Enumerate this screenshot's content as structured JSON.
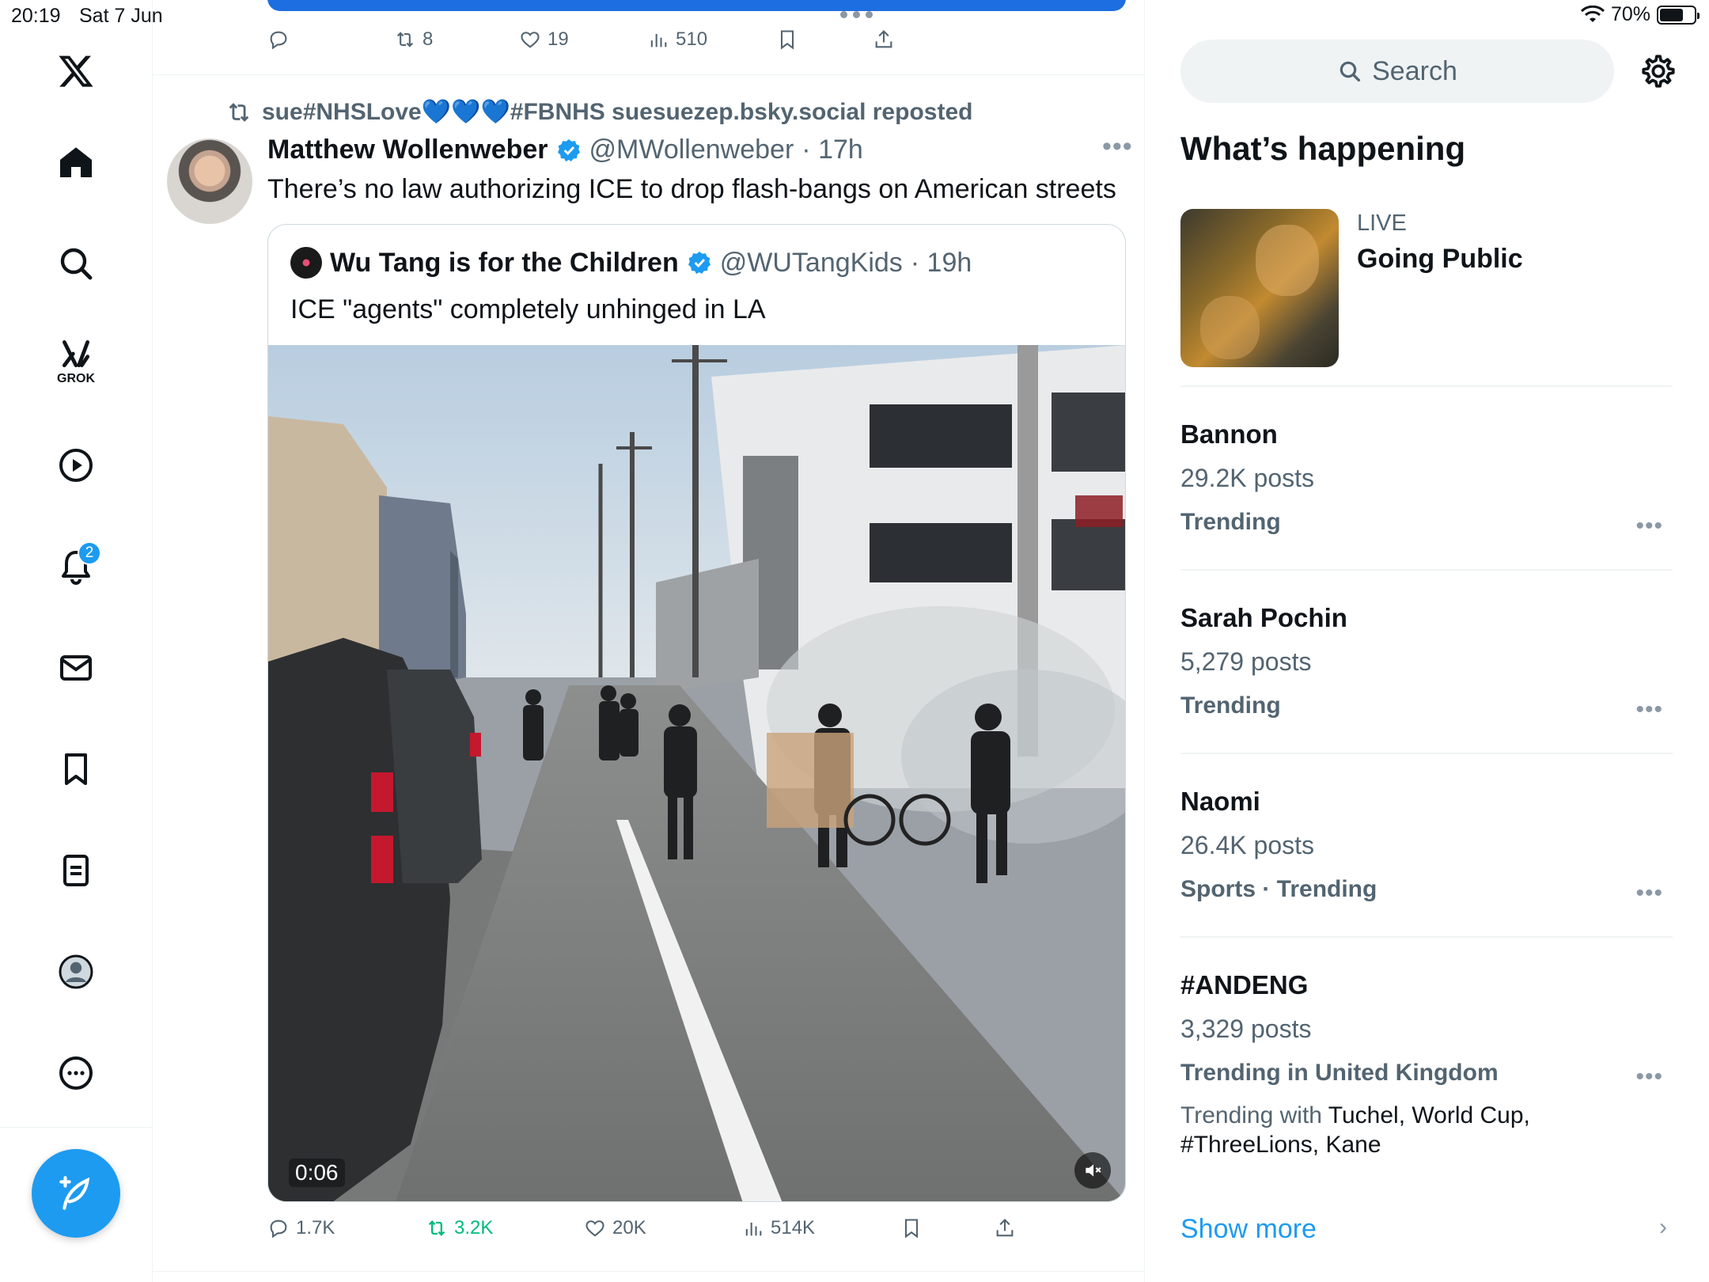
{
  "status_bar": {
    "time": "20:19",
    "date": "Sat 7 Jun",
    "battery": "70%"
  },
  "nav": {
    "grok_label": "GROK",
    "notifications_badge": "2"
  },
  "previous_post": {
    "actions": {
      "reply": "",
      "repost": "8",
      "like": "19",
      "views": "510"
    }
  },
  "post": {
    "reposted_by": "sue#NHSLove💙💙💙#FBNHS suesuezep.bsky.social reposted",
    "author_name": "Matthew Wollenweber",
    "author_handle": "@MWollenweber",
    "time": "· 17h",
    "text": "There’s no law authorizing ICE to drop flash-bangs on American streets",
    "quote": {
      "author_name": "Wu Tang is for the Children",
      "author_handle": "@WUTangKids",
      "time": "· 19h",
      "text": "ICE \"agents\" completely unhinged in LA",
      "video_time": "0:06"
    },
    "actions": {
      "reply": "1.7K",
      "repost": "3.2K",
      "like": "20K",
      "views": "514K"
    }
  },
  "right": {
    "search_placeholder": "Search",
    "title": "What’s happening",
    "live": {
      "label": "LIVE",
      "title": "Going Public"
    },
    "trends": [
      {
        "name": "Bannon",
        "posts": "29.2K posts",
        "category": "Trending"
      },
      {
        "name": "Sarah Pochin",
        "posts": "5,279 posts",
        "category": "Trending"
      },
      {
        "name": "Naomi",
        "posts": "26.4K posts",
        "category": "Sports · Trending"
      },
      {
        "name": "#ANDENG",
        "posts": "3,329 posts",
        "category": "Trending in United Kingdom",
        "with_label": "Trending with",
        "with_items": "Tuchel, World Cup, #ThreeLions, Kane"
      }
    ],
    "show_more": "Show more"
  },
  "colors": {
    "accent": "#1d9bf0",
    "repost_green": "#00ba7c",
    "muted": "#536471"
  },
  "icons": [
    "x-logo-icon",
    "home-icon",
    "search-icon",
    "grok-icon",
    "video-icon",
    "bell-icon",
    "mail-icon",
    "bookmark-icon",
    "list-icon",
    "profile-icon",
    "more-icon",
    "compose-icon",
    "gear-icon"
  ]
}
